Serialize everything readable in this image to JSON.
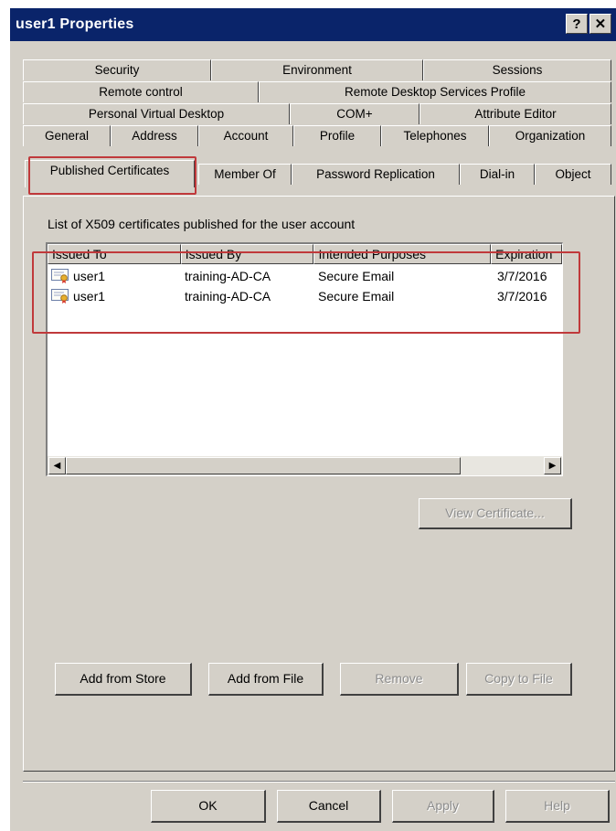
{
  "window": {
    "title": "user1 Properties",
    "help_button": "?",
    "close_button": "✕"
  },
  "tabs": {
    "row1": [
      "Security",
      "Environment",
      "Sessions"
    ],
    "row2": [
      "Remote control",
      "Remote Desktop Services Profile"
    ],
    "row3": [
      "Personal Virtual Desktop",
      "COM+",
      "Attribute Editor"
    ],
    "row4": [
      "General",
      "Address",
      "Account",
      "Profile",
      "Telephones",
      "Organization"
    ],
    "row5": [
      "Published Certificates",
      "Member Of",
      "Password Replication",
      "Dial-in",
      "Object"
    ],
    "active": "Published Certificates"
  },
  "panel": {
    "caption": "List of X509 certificates published for the user account",
    "columns": [
      "Issued To",
      "Issued By",
      "Intended Purposes",
      "Expiration"
    ],
    "rows": [
      {
        "issued_to": "user1",
        "issued_by": "training-AD-CA",
        "purposes": "Secure Email",
        "expiration": "3/7/2016"
      },
      {
        "issued_to": "user1",
        "issued_by": "training-AD-CA",
        "purposes": "Secure Email",
        "expiration": "3/7/2016"
      }
    ],
    "view_certificate_label": "View Certificate...",
    "add_from_store_label": "Add from Store",
    "add_from_file_label": "Add from File",
    "remove_label": "Remove",
    "copy_to_file_label": "Copy to File"
  },
  "footer": {
    "ok_label": "OK",
    "cancel_label": "Cancel",
    "apply_label": "Apply",
    "help_label": "Help"
  },
  "colors": {
    "titlebar": "#0a246a",
    "dialog_face": "#d4d0c8",
    "highlight_border": "#c0393b"
  },
  "icons": {
    "certificate": "certificate-icon",
    "scroll_left": "scroll-left-arrow-icon",
    "scroll_right": "scroll-right-arrow-icon"
  }
}
